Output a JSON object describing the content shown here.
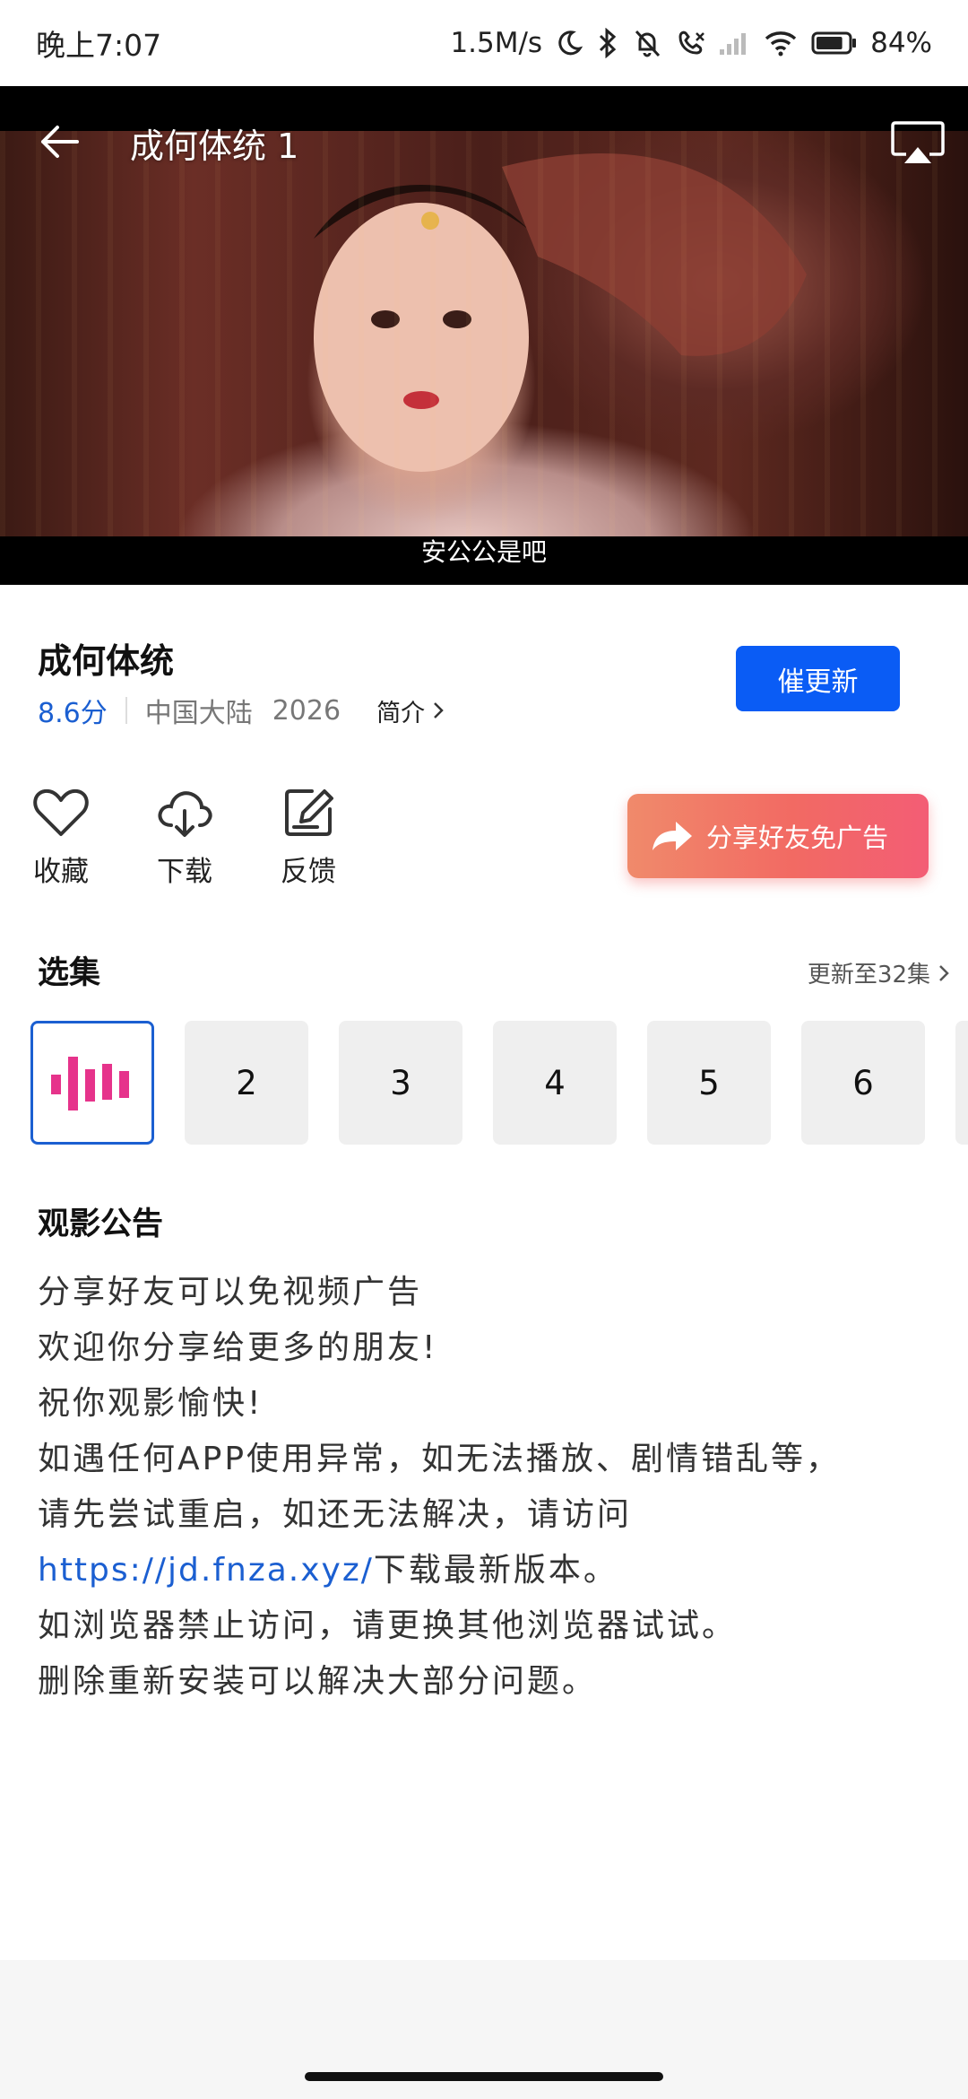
{
  "status_bar": {
    "time": "晚上7:07",
    "speed": "1.5M/s",
    "battery": "84%",
    "battery_level": 0.84
  },
  "player": {
    "title": "成何体统 1",
    "subtitle": "安公公是吧"
  },
  "info": {
    "title": "成何体统",
    "rating": "8.6分",
    "region": "中国大陆",
    "year": "2026",
    "intro_label": "简介",
    "update_button": "催更新"
  },
  "actions": {
    "favorite": "收藏",
    "download": "下载",
    "feedback": "反馈",
    "share": "分享好友免广告"
  },
  "episodes": {
    "title": "选集",
    "more": "更新至32集",
    "items": [
      "2",
      "3",
      "4",
      "5",
      "6"
    ]
  },
  "notice": {
    "title": "观影公告",
    "lines": [
      "分享好友可以免视频广告",
      "欢迎你分享给更多的朋友!",
      "祝你观影愉快!",
      "如遇任何APP使用异常，如无法播放、剧情错乱等，",
      "请先尝试重启，如还无法解决，请访问"
    ],
    "link": "https://jd.fnza.xyz/",
    "link_suffix": "下载最新版本。",
    "line7": "如浏览器禁止访问，请更换其他浏览器试试。",
    "line8": "删除重新安装可以解决大部分问题。"
  },
  "colors": {
    "accent": "#1b5fd1",
    "button_blue": "#0a5cf5",
    "share_gradient_start": "#f08a6b",
    "share_gradient_end": "#f35d75",
    "playing_bars": "#e6338b"
  }
}
